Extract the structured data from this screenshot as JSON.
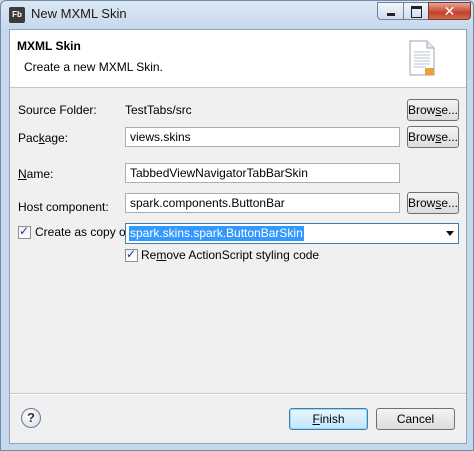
{
  "window": {
    "title": "New MXML Skin",
    "app_icon": "Fb"
  },
  "header": {
    "title": "MXML Skin",
    "description": "Create a new MXML Skin."
  },
  "form": {
    "source_folder": {
      "label": "Source Folder:",
      "value": "TestTabs/src"
    },
    "package": {
      "label_pre": "Pac",
      "label_accel": "k",
      "label_post": "age:",
      "value": "views.skins"
    },
    "name": {
      "label_pre": "",
      "label_accel": "N",
      "label_post": "ame:",
      "value": "TabbedViewNavigatorTabBarSkin"
    },
    "host_component": {
      "label": "Host component:",
      "value": "spark.components.ButtonBar"
    },
    "create_as_copy": {
      "label": "Create as copy of:",
      "checked": true,
      "value": "spark.skins.spark.ButtonBarSkin"
    },
    "remove_actionscript": {
      "label_pre": "Re",
      "label_accel": "m",
      "label_post": "ove ActionScript styling code",
      "checked": true
    },
    "browse_pre": "Brow",
    "browse_accel": "s",
    "browse_post": "e..."
  },
  "buttons": {
    "help": "?",
    "finish_accel": "F",
    "finish_post": "inish",
    "cancel": "Cancel"
  },
  "colors": {
    "selection": "#3399ff",
    "close_button": "#c4412c"
  }
}
